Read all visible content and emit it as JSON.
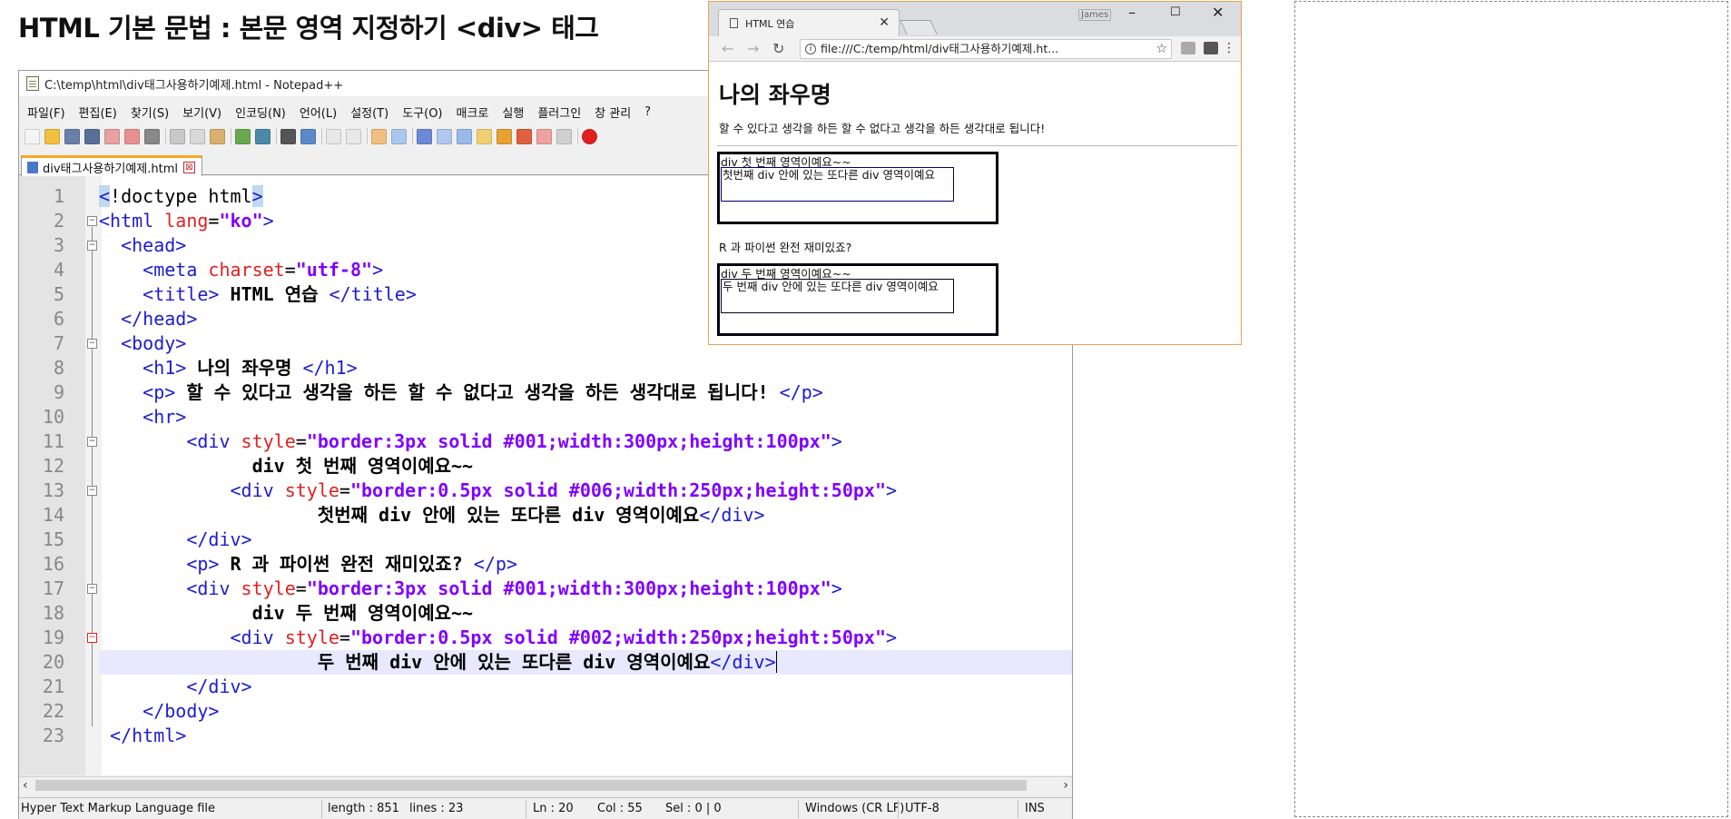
{
  "slide": {
    "title": "HTML 기본 문법 : 본문 영역 지정하기   <div> 태그"
  },
  "notepad": {
    "window_title": "C:\\temp\\html\\div태그사용하기예제.html - Notepad++",
    "menu": [
      "파일(F)",
      "편집(E)",
      "찾기(S)",
      "보기(V)",
      "인코딩(N)",
      "언어(L)",
      "설정(T)",
      "도구(O)",
      "매크로",
      "실행",
      "플러그인",
      "창 관리",
      "?"
    ],
    "tab_label": "div태그사용하기예제.html",
    "tab_close": "⊠",
    "line_numbers": [
      "1",
      "2",
      "3",
      "4",
      "5",
      "6",
      "7",
      "8",
      "9",
      "10",
      "11",
      "12",
      "13",
      "14",
      "15",
      "16",
      "17",
      "18",
      "19",
      "20",
      "21",
      "22",
      "23"
    ],
    "status": {
      "file_type": "Hyper Text Markup Language file",
      "length": "length : 851",
      "lines": "lines : 23",
      "ln": "Ln : 20",
      "col": "Col : 55",
      "sel": "Sel : 0 | 0",
      "eol": "Windows (CR LF)",
      "encoding": "UTF-8",
      "mode": "INS"
    },
    "code": {
      "l1a": "<",
      "l1b": "!",
      "l1c": "doctype html",
      "l1d": ">",
      "l2a": "<html ",
      "l2b": "lang",
      "l2c": "=",
      "l2d": "\"ko\"",
      "l2e": ">",
      "l3a": "  <head>",
      "l4a": "    <meta ",
      "l4b": "charset",
      "l4c": "=",
      "l4d": "\"utf-8\"",
      "l4e": ">",
      "l5a": "    <title>",
      "l5b": " HTML 연습 ",
      "l5c": "</title>",
      "l6a": "  </head>",
      "l7a": "  <body>",
      "l8a": "    <h1>",
      "l8b": " 나의 좌우명 ",
      "l8c": "</h1>",
      "l9a": "    <p>",
      "l9b": " 할 수 있다고 생각을 하든 할 수 없다고 생각을 하든 생각대로 됩니다! ",
      "l9c": "</p>",
      "l10a": "    <hr>",
      "l11a": "        <div ",
      "l11b": "style",
      "l11c": "=",
      "l11d": "\"border:3px solid #001;width:300px;height:100px\"",
      "l11e": ">",
      "l12a": "              div 첫 번째 영역이예요~~",
      "l13a": "            <div ",
      "l13b": "style",
      "l13c": "=",
      "l13d": "\"border:0.5px solid #006;width:250px;height:50px\"",
      "l13e": ">",
      "l14a": "                    첫번째 div 안에 있는 또다른 div 영역이예요",
      "l14b": "</div>",
      "l15a": "        </div>",
      "l16a": "        <p>",
      "l16b": " R 과 파이썬 완전 재미있죠? ",
      "l16c": "</p>",
      "l17a": "        <div ",
      "l17b": "style",
      "l17c": "=",
      "l17d": "\"border:3px solid #001;width:300px;height:100px\"",
      "l17e": ">",
      "l18a": "              div 두 번째 영역이예요~~",
      "l19a": "            <div ",
      "l19b": "style",
      "l19c": "=",
      "l19d": "\"border:0.5px solid #002;width:250px;height:50px\"",
      "l19e": ">",
      "l20a": "                    두 번째 div 안에 있는 또다른 div 영역이예요",
      "l20b": "</div>",
      "l21a": "        </div>",
      "l22a": "    </body>",
      "l23a": " </html>"
    }
  },
  "browser": {
    "tab_title": "HTML 연습",
    "tab_close": "✕",
    "user": "James",
    "url": "file:///C:/temp/html/div태그사용하기예제.ht...",
    "page": {
      "h1": "나의 좌우명",
      "p": "할 수 있다고 생각을 하든 할 수 없다고 생각을 하든 생각대로 됩니다!",
      "div1_text": "div 첫 번째 영역이예요~~",
      "div1_inner": "첫번째 div 안에 있는 또다른 div 영역이예요",
      "p2": "R 과 파이썬 완전 재미있죠?",
      "div2_text": "div 두 번째 영역이예요~~",
      "div2_inner": "두 번째 div 안에 있는 또다른 div 영역이예요"
    }
  },
  "colors": {
    "tag": "#1c1cd0",
    "attribute": "#e02020",
    "value": "#8000ff",
    "current_line": "#e8e8ff",
    "browser_border": "#f0a050",
    "tab_accent": "#f5a623"
  }
}
